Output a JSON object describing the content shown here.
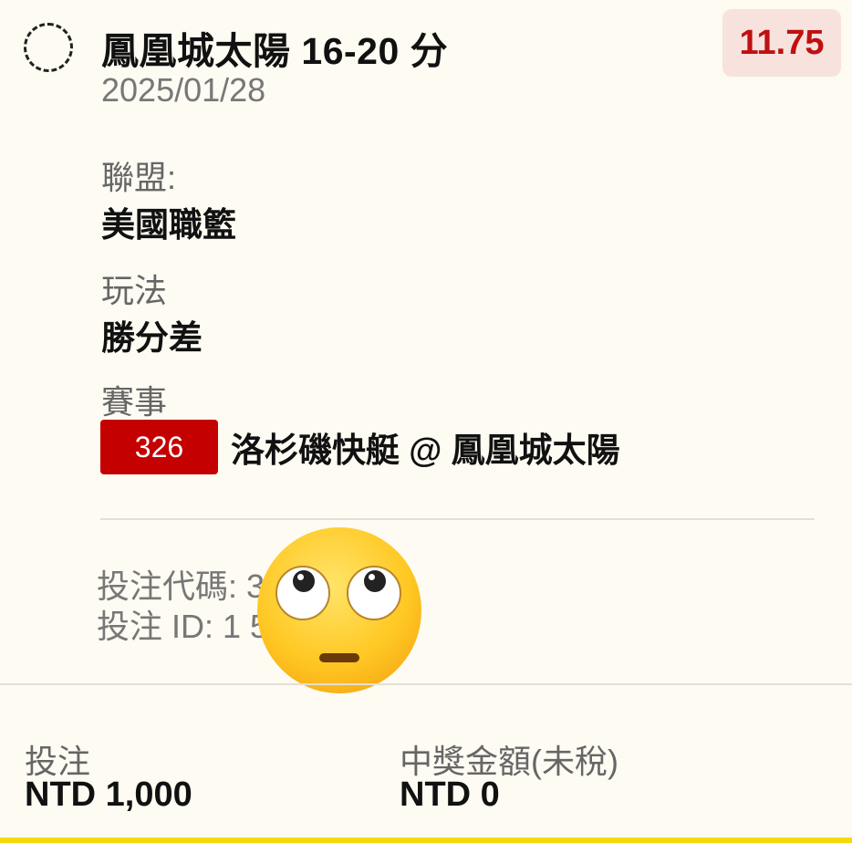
{
  "ticket": {
    "title": "鳳凰城太陽 16-20 分",
    "date": "2025/01/28",
    "odds": "11.75"
  },
  "details": {
    "league_label": "聯盟:",
    "league_value": "美國職籃",
    "play_label": "玩法",
    "play_value": "勝分差",
    "event_label": "賽事",
    "event_number": "326",
    "event_name": "洛杉磯快艇 @ 鳳凰城太陽"
  },
  "reference": {
    "bet_code": "投注代碼: 338",
    "bet_id": "投注 ID: 1 5.1"
  },
  "footer": {
    "stake_label": "投注",
    "stake_value": "NTD 1,000",
    "payout_label": "中獎金額(未稅)",
    "payout_value": "NTD 0"
  },
  "icons": {
    "status": "pending-dashed-circle-icon",
    "overlay": "eye-roll-emoji"
  },
  "colors": {
    "accent_red": "#c40000",
    "odds_bg": "#f8e2de",
    "background": "#fdfbf2",
    "bottom_bar": "#f5d90a"
  }
}
